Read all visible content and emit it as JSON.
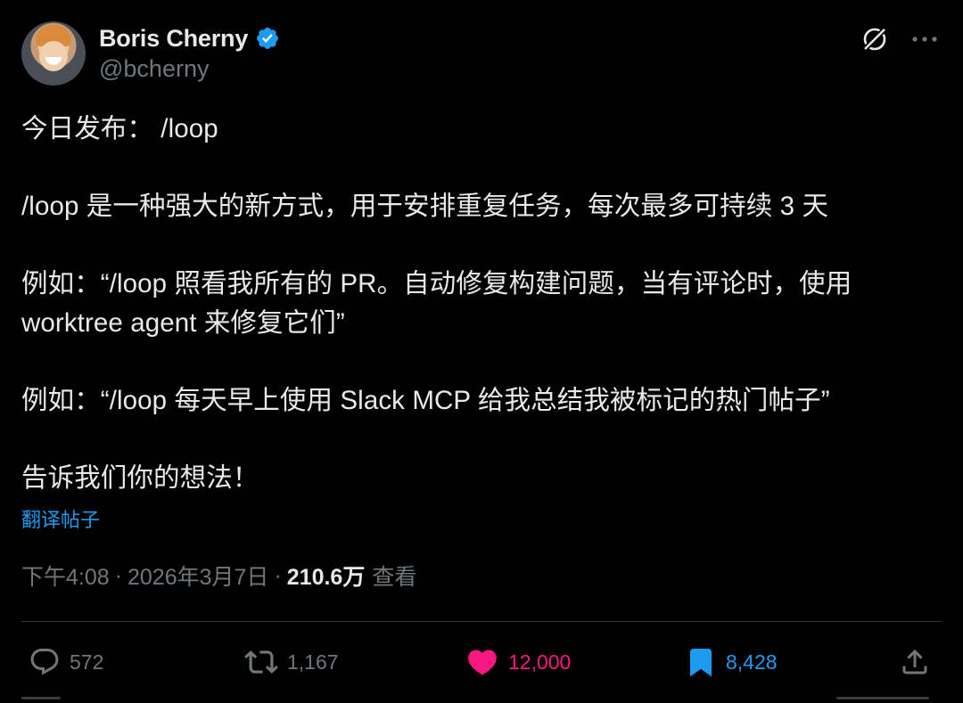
{
  "author": {
    "display_name": "Boris Cherny",
    "handle": "@bcherny",
    "verified": true,
    "verified_color": "#1d9bf0"
  },
  "header_actions": {
    "grok_icon": "grok-slash-icon",
    "more_icon": "more-dots-icon"
  },
  "tweet": {
    "paragraphs": [
      "今日发布： /loop",
      "/loop 是一种强大的新方式，用于安排重复任务，每次最多可持续 3 天",
      "例如：“/loop 照看我所有的 PR。自动修复构建问题，当有评论时，使用 worktree agent 来修复它们”",
      "例如：“/loop 每天早上使用 Slack MCP 给我总结我被标记的热门帖子”",
      "告诉我们你的想法！"
    ],
    "translate_link": "翻译帖子"
  },
  "meta": {
    "time": "下午4:08",
    "date": "2026年3月7日",
    "views_count": "210.6万",
    "views_label": "查看"
  },
  "actions": {
    "replies": "572",
    "reposts": "1,167",
    "likes": "12,000",
    "bookmarks": "8,428",
    "liked_color": "#f91880",
    "bookmarked_color": "#1d9bf0"
  }
}
